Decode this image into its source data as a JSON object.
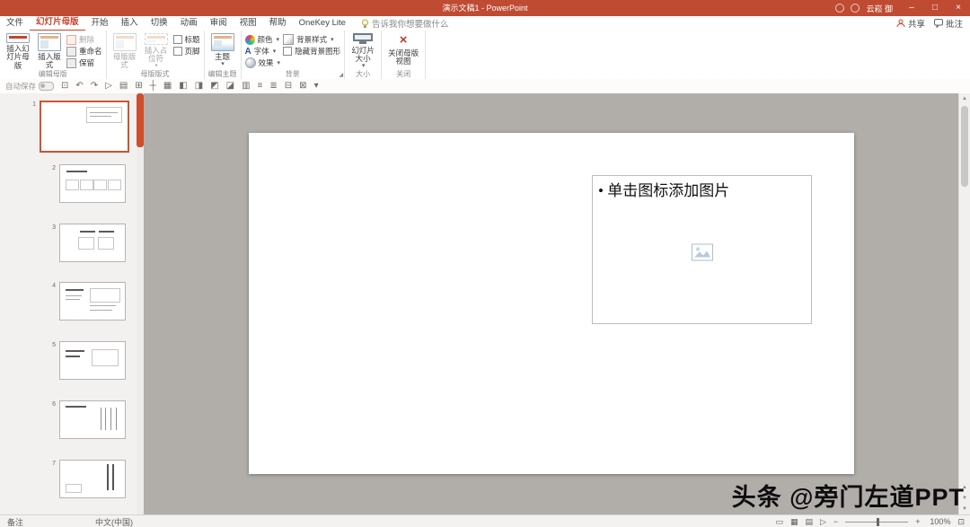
{
  "colors": {
    "titlebar": "#BF4B32",
    "accent": "#C8432C",
    "selection": "#CE4E2D",
    "canvas": "#B1AEAA"
  },
  "title_bar": {
    "title": "演示文稿1 - PowerPoint",
    "user": "云崧 御"
  },
  "tabs": [
    {
      "label": "文件"
    },
    {
      "label": "幻灯片母版",
      "active": true
    },
    {
      "label": "开始"
    },
    {
      "label": "插入"
    },
    {
      "label": "切换"
    },
    {
      "label": "动画"
    },
    {
      "label": "审阅"
    },
    {
      "label": "视图"
    },
    {
      "label": "帮助"
    },
    {
      "label": "OneKey Lite"
    }
  ],
  "tell_me": "告诉我你想要做什么",
  "top_actions": {
    "share": "共享",
    "comments": "批注"
  },
  "ribbon": {
    "groups": [
      {
        "label": "编辑母版",
        "insert_master": "插入幻灯片母版",
        "insert_layout": "插入版式",
        "delete": "删除",
        "rename": "重命名",
        "preserve": "保留"
      },
      {
        "label": "母版版式",
        "master_layout": "母版版式",
        "insert_placeholder": "插入占位符",
        "title_cb": "标题",
        "footer_cb": "页脚"
      },
      {
        "label": "编辑主题",
        "themes": "主题"
      },
      {
        "label": "背景",
        "colors": "颜色",
        "fonts": "字体",
        "effects": "效果",
        "bg_styles": "背景样式",
        "hide_bg": "隐藏背景图形"
      },
      {
        "label": "大小",
        "slide_size": "幻灯片大小"
      },
      {
        "label": "关闭",
        "close_master": "关闭母版视图"
      }
    ]
  },
  "qat": {
    "autosave": "自动保存",
    "icons": [
      {
        "name": "save",
        "glyph": "⊡"
      },
      {
        "name": "undo",
        "glyph": "↶"
      },
      {
        "name": "redo",
        "glyph": "↷"
      },
      {
        "name": "start-slideshow",
        "glyph": "▷"
      },
      {
        "name": "print",
        "glyph": "▤"
      },
      {
        "name": "grid",
        "glyph": "⊞"
      },
      {
        "name": "guides",
        "glyph": "┼"
      },
      {
        "name": "snap",
        "glyph": "▦"
      },
      {
        "name": "align-left",
        "glyph": "◧"
      },
      {
        "name": "align-right",
        "glyph": "◨"
      },
      {
        "name": "align-top",
        "glyph": "◩"
      },
      {
        "name": "align-bottom",
        "glyph": "◪"
      },
      {
        "name": "distribute",
        "glyph": "▥"
      },
      {
        "name": "align-text",
        "glyph": "≡"
      },
      {
        "name": "list",
        "glyph": "≣"
      },
      {
        "name": "send-backward",
        "glyph": "⊟"
      },
      {
        "name": "bring-forward",
        "glyph": "⊠"
      },
      {
        "name": "qat-more",
        "glyph": "▾"
      }
    ]
  },
  "thumbnails": [
    {
      "num": "1"
    },
    {
      "num": "2"
    },
    {
      "num": "3"
    },
    {
      "num": "4"
    },
    {
      "num": "5"
    },
    {
      "num": "6"
    },
    {
      "num": "7"
    }
  ],
  "slide": {
    "bullet": "•",
    "placeholder_text": "单击图标添加图片"
  },
  "watermark": "头条 @旁门左道PPT",
  "status_bar": {
    "notes": "备注",
    "language": "中文(中国)",
    "zoom": "100%"
  },
  "glyphs": {
    "chevron": "▾",
    "minimize": "–",
    "maximize": "□",
    "close": "×",
    "launcher": "◢",
    "font_a": "A",
    "view_normal": "▭",
    "view_sorter": "▦",
    "view_reading": "▤",
    "view_slideshow": "▷",
    "zoom_minus": "−",
    "zoom_plus": "+",
    "fit": "⊡",
    "scroll_up": "▲",
    "scroll_down": "▼"
  }
}
